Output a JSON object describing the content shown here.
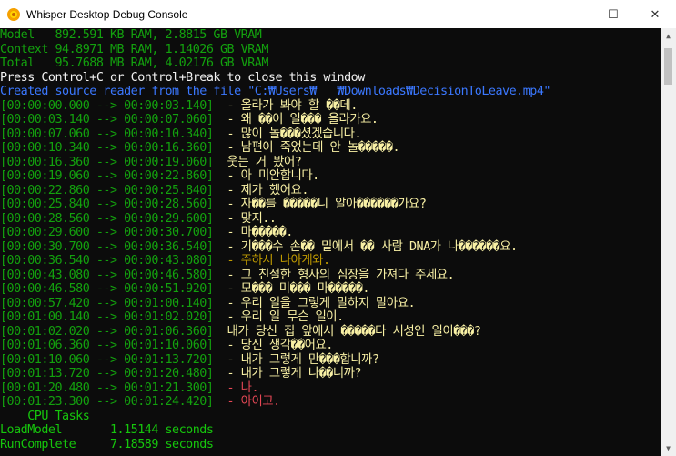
{
  "window": {
    "title": "Whisper Desktop Debug Console",
    "minimize_glyph": "—",
    "maximize_glyph": "☐",
    "close_glyph": "✕"
  },
  "console": {
    "header_lines": [
      {
        "text": "Model   892.591 KB RAM, 2.8815 GB VRAM",
        "color": "green"
      },
      {
        "text": "Context 94.8971 MB RAM, 1.14026 GB VRAM",
        "color": "green"
      },
      {
        "text": "Total   95.7688 MB RAM, 4.02176 GB VRAM",
        "color": "green"
      },
      {
        "text": "Press Control+C or Control+Break to close this window",
        "color": "white"
      },
      {
        "text": "Created source reader from the file \"C:₩Users₩   ₩Downloads₩DecisionToLeave.mp4\"",
        "color": "blue"
      }
    ],
    "subtitle_lines": [
      {
        "time": "[00:00:00.000 --> 00:00:03.140]",
        "text": "  - 올라가 봐야 할 ��데.",
        "color": "yellow"
      },
      {
        "time": "[00:00:03.140 --> 00:00:07.060]",
        "text": "  - 왜 ��이 일��� 올라가요.",
        "color": "yellow"
      },
      {
        "time": "[00:00:07.060 --> 00:00:10.340]",
        "text": "  - 많이 놀���셨겠습니다.",
        "color": "yellow"
      },
      {
        "time": "[00:00:10.340 --> 00:00:16.360]",
        "text": "  - 남편이 죽었는데 안 놀�����.",
        "color": "yellow"
      },
      {
        "time": "[00:00:16.360 --> 00:00:19.060]",
        "text": "  웃는 거 봤어?",
        "color": "yellow"
      },
      {
        "time": "[00:00:19.060 --> 00:00:22.860]",
        "text": "  - 아 미안합니다.",
        "color": "yellow"
      },
      {
        "time": "[00:00:22.860 --> 00:00:25.840]",
        "text": "  - 제가 했어요.",
        "color": "yellow"
      },
      {
        "time": "[00:00:25.840 --> 00:00:28.560]",
        "text": "  - 자��를 �����니 알아������가요?",
        "color": "yellow"
      },
      {
        "time": "[00:00:28.560 --> 00:00:29.600]",
        "text": "  - 맞지..",
        "color": "yellow"
      },
      {
        "time": "[00:00:29.600 --> 00:00:30.700]",
        "text": "  - 마�����.",
        "color": "yellow"
      },
      {
        "time": "[00:00:30.700 --> 00:00:36.540]",
        "text": "  - 기���수 손�� 밑에서 �� 사람 DNA가 나������요.",
        "color": "yellow"
      },
      {
        "time": "[00:00:36.540 --> 00:00:43.080]",
        "text": "  - 주하시 나아게와.",
        "color": "orange"
      },
      {
        "time": "[00:00:43.080 --> 00:00:46.580]",
        "text": "  - 그 친절한 형사의 심장을 가져다 주세요.",
        "color": "yellow"
      },
      {
        "time": "[00:00:46.580 --> 00:00:51.920]",
        "text": "  - 모��� 미��� 마�����.",
        "color": "yellow"
      },
      {
        "time": "[00:00:57.420 --> 00:01:00.140]",
        "text": "  - 우리 일을 그렇게 말하지 말아요.",
        "color": "yellow"
      },
      {
        "time": "[00:01:00.140 --> 00:01:02.020]",
        "text": "  - 우리 일 무슨 일이.",
        "color": "yellow"
      },
      {
        "time": "[00:01:02.020 --> 00:01:06.360]",
        "text": "  내가 당신 집 앞에서 �����다 서성인 일이���?",
        "color": "yellow"
      },
      {
        "time": "[00:01:06.360 --> 00:01:10.060]",
        "text": "  - 당신 생각��어요.",
        "color": "yellow"
      },
      {
        "time": "[00:01:10.060 --> 00:01:13.720]",
        "text": "  - 내가 그렇게 만���합니까?",
        "color": "yellow"
      },
      {
        "time": "[00:01:13.720 --> 00:01:20.480]",
        "text": "  - 내가 그렇게 나��니까?",
        "color": "yellow"
      },
      {
        "time": "[00:01:20.480 --> 00:01:21.300]",
        "text": "  - 나.",
        "color": "red"
      },
      {
        "time": "[00:01:23.300 --> 00:01:24.420]",
        "text": "  - 아이고.",
        "color": "red"
      }
    ],
    "footer_lines": [
      {
        "text": "    CPU Tasks",
        "color": "lgreen"
      },
      {
        "text": "LoadModel       1.15144 seconds",
        "color": "lgreen"
      },
      {
        "text": "RunComplete     7.18589 seconds",
        "color": "lgreen"
      }
    ]
  },
  "colors": {
    "green": "#13a10e",
    "lgreen": "#16c60c",
    "white": "#f2f2f2",
    "blue": "#3b78ff",
    "yellow": "#f9f1a5",
    "orange": "#c19c00",
    "red": "#e74856",
    "background": "#0c0c0c"
  },
  "icons": {
    "app": "sun-flower-icon",
    "scroll_up": "chevron-up-icon",
    "scroll_down": "chevron-down-icon"
  }
}
